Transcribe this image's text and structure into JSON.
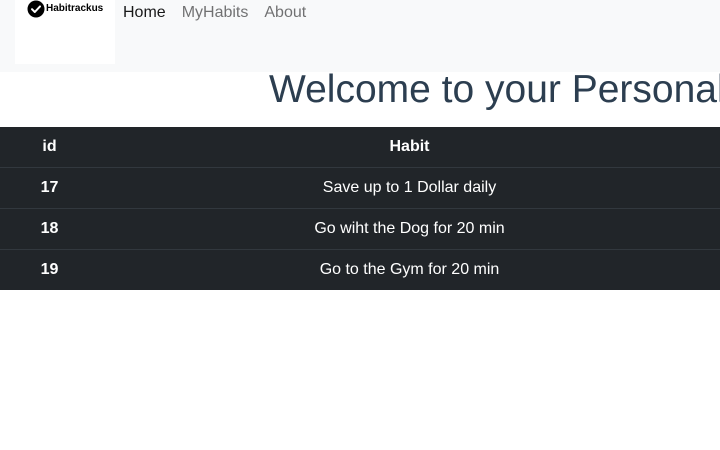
{
  "navbar": {
    "brand_name": "Habitrackus",
    "links": [
      {
        "label": "Home",
        "active": true
      },
      {
        "label": "MyHabits",
        "active": false
      },
      {
        "label": "About",
        "active": false
      }
    ]
  },
  "main": {
    "welcome_heading": "Welcome to your Personal",
    "table": {
      "headers": [
        "id",
        "Habit"
      ],
      "rows": [
        {
          "id": "17",
          "habit": "Save up to 1 Dollar daily"
        },
        {
          "id": "18",
          "habit": "Go wiht the Dog for 20 min"
        },
        {
          "id": "19",
          "habit": "Go to the Gym for 20 min"
        }
      ]
    }
  },
  "colors": {
    "navbar_bg": "#f8f9fa",
    "table_bg": "#212529",
    "heading_color": "#2c3e50"
  }
}
